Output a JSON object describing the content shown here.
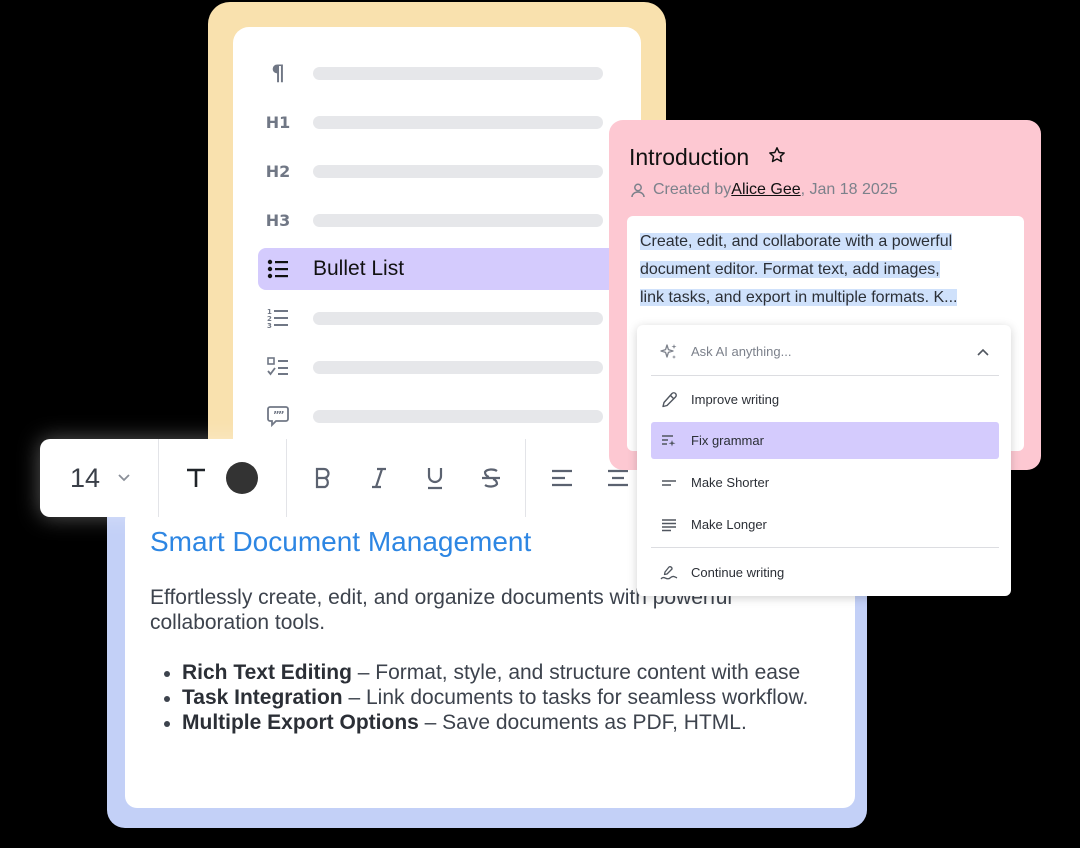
{
  "blocks_menu": {
    "items": [
      {
        "icon": "paragraph-icon",
        "glyph": "¶",
        "label": ""
      },
      {
        "icon": "heading1-icon",
        "glyph": "H1",
        "label": ""
      },
      {
        "icon": "heading2-icon",
        "glyph": "H2",
        "label": ""
      },
      {
        "icon": "heading3-icon",
        "glyph": "H3",
        "label": ""
      },
      {
        "icon": "bullet-list-icon",
        "glyph": "",
        "label": "Bullet List"
      },
      {
        "icon": "numbered-list-icon",
        "glyph": "",
        "label": ""
      },
      {
        "icon": "checklist-icon",
        "glyph": "",
        "label": ""
      },
      {
        "icon": "quote-icon",
        "glyph": "",
        "label": ""
      }
    ]
  },
  "toolbar": {
    "font_size": "14",
    "text_color": "#333333"
  },
  "document": {
    "title": "Smart Document Management",
    "description": "Effortlessly create, edit, and organize documents with powerful collaboration tools.",
    "features": [
      {
        "name": "Rich Text Editing",
        "text": " – Format, style, and structure content with ease"
      },
      {
        "name": "Task Integration",
        "text": " – Link documents to tasks for seamless workflow."
      },
      {
        "name": "Multiple Export Options",
        "text": " – Save documents as PDF, HTML."
      }
    ]
  },
  "intro": {
    "title": "Introduction",
    "meta_prefix": "Created by ",
    "author": "Alice Gee",
    "date": ", Jan 18 2025",
    "text_line1": "Create, edit, and collaborate with a powerful",
    "text_line2": "document editor. Format text, add images,",
    "text_line3": "link tasks, and export in multiple formats. K..."
  },
  "ai_menu": {
    "placeholder": "Ask AI anything...",
    "items": [
      {
        "icon": "pen-icon",
        "label": "Improve writing"
      },
      {
        "icon": "fix-grammar-icon",
        "label": "Fix grammar"
      },
      {
        "icon": "make-shorter-icon",
        "label": "Make Shorter"
      },
      {
        "icon": "make-longer-icon",
        "label": "Make Longer"
      },
      {
        "icon": "continue-writing-icon",
        "label": "Continue writing"
      }
    ]
  },
  "colors": {
    "yellow_frame": "#f9e1ae",
    "pink_frame": "#fdc8d2",
    "blue_frame": "#c3d0f7",
    "highlight": "#d4cbfd",
    "title_blue": "#2d86e3"
  }
}
